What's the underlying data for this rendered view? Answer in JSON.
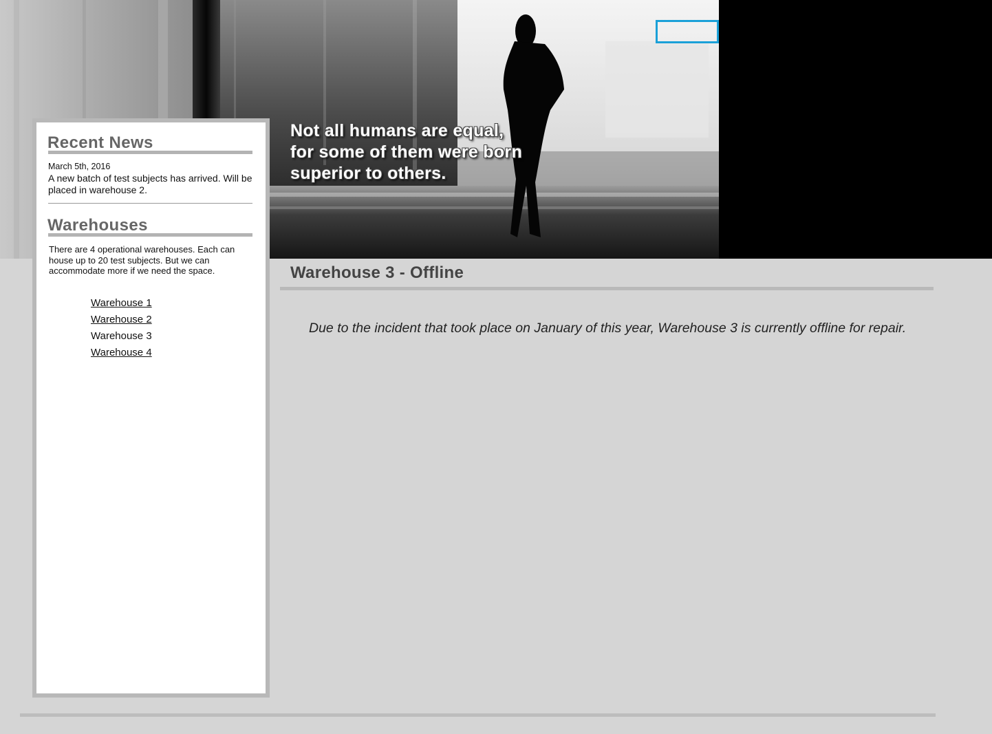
{
  "hero": {
    "quote_lines": [
      "Not all humans are equal,",
      "for some of them were born",
      "superior to others."
    ],
    "focus_box_color": "#1aa0d8"
  },
  "sidebar": {
    "news": {
      "heading": "Recent News",
      "date": "March 5th, 2016",
      "text": "A new batch of test subjects has arrived. Will be placed in warehouse 2."
    },
    "warehouses": {
      "heading": "Warehouses",
      "description": "There are 4 operational warehouses. Each can house up to 20 test subjects. But we can accommodate more if we need the space.",
      "links": [
        {
          "label": "Warehouse 1",
          "current": false
        },
        {
          "label": "Warehouse 2",
          "current": false
        },
        {
          "label": "Warehouse 3",
          "current": true
        },
        {
          "label": "Warehouse 4",
          "current": false
        }
      ]
    }
  },
  "main": {
    "title": "Warehouse 3 - Offline",
    "message": "Due to the incident that took place on January of this year, Warehouse 3 is currently offline for repair."
  },
  "colors": {
    "page_background": "#d5d5d5",
    "sidebar_border": "#b8b8b8",
    "heading_gray": "#666666",
    "accent_blue": "#1aa0d8"
  }
}
